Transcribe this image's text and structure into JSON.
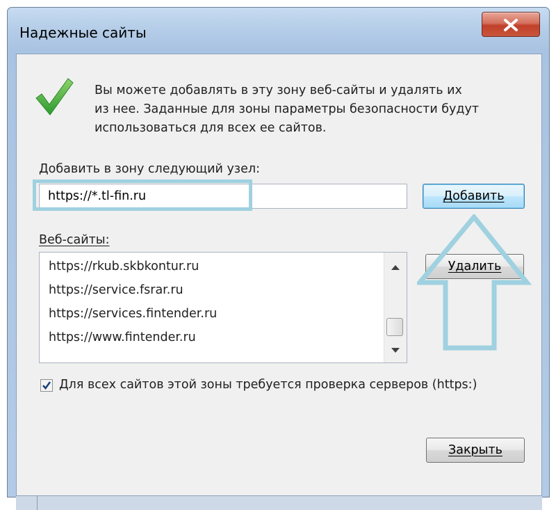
{
  "window": {
    "title": "Надежные сайты",
    "close_icon": "close-x-icon"
  },
  "info": {
    "icon": "green-checkmark-icon",
    "text_lines": [
      "Вы можете добавлять в эту зону  веб-сайты и удалять их",
      "из нее. Заданные для зоны параметры безопасности будут",
      "использоваться для всех ее сайтов."
    ]
  },
  "add_zone": {
    "label": "Добавить в зону следующий узел:",
    "input_value": "https://*.tl-fin.ru",
    "add_button": "Добавить"
  },
  "websites": {
    "label": "Веб-сайты:",
    "items": [
      "https://rkub.skbkontur.ru",
      "https://service.fsrar.ru",
      "https://services.fintender.ru",
      "https://www.fintender.ru"
    ],
    "remove_button": "Удалить"
  },
  "https_check": {
    "checked": true,
    "label": "Для всех сайтов этой зоны требуется проверка серверов (https:)"
  },
  "close_button": "Закрыть",
  "colors": {
    "annotation": "#9fd1e0",
    "checkmark": "#3fae3f",
    "titlebar": "#b5cde8",
    "close_button": "#c1402a"
  }
}
